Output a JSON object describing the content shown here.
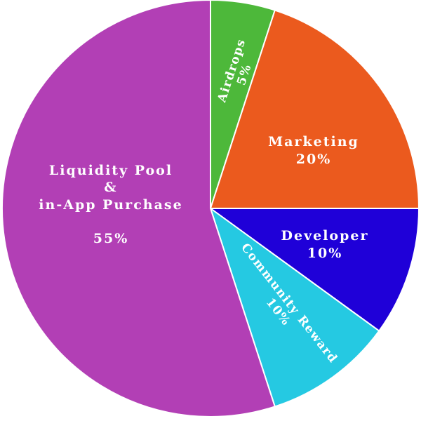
{
  "chart_data": {
    "type": "pie",
    "title": "",
    "slices": [
      {
        "label": "Airdrops",
        "value": 5,
        "value_label": "5%",
        "color": "#4db83a"
      },
      {
        "label": "Marketing",
        "value": 20,
        "value_label": "20%",
        "color": "#eb5a1e"
      },
      {
        "label": "Developer",
        "value": 10,
        "value_label": "10%",
        "color": "#1f00d8"
      },
      {
        "label": "Community Reward",
        "value": 10,
        "value_label": "10%",
        "color": "#25c9e2"
      },
      {
        "label_lines": [
          "Liquidity Pool",
          "&",
          "in-App Purchase"
        ],
        "label": "Liquidity Pool & in-App Purchase",
        "value": 55,
        "value_label": "55%",
        "color": "#b23fb5"
      }
    ],
    "start_angle_deg": 0,
    "direction": "clockwise"
  }
}
